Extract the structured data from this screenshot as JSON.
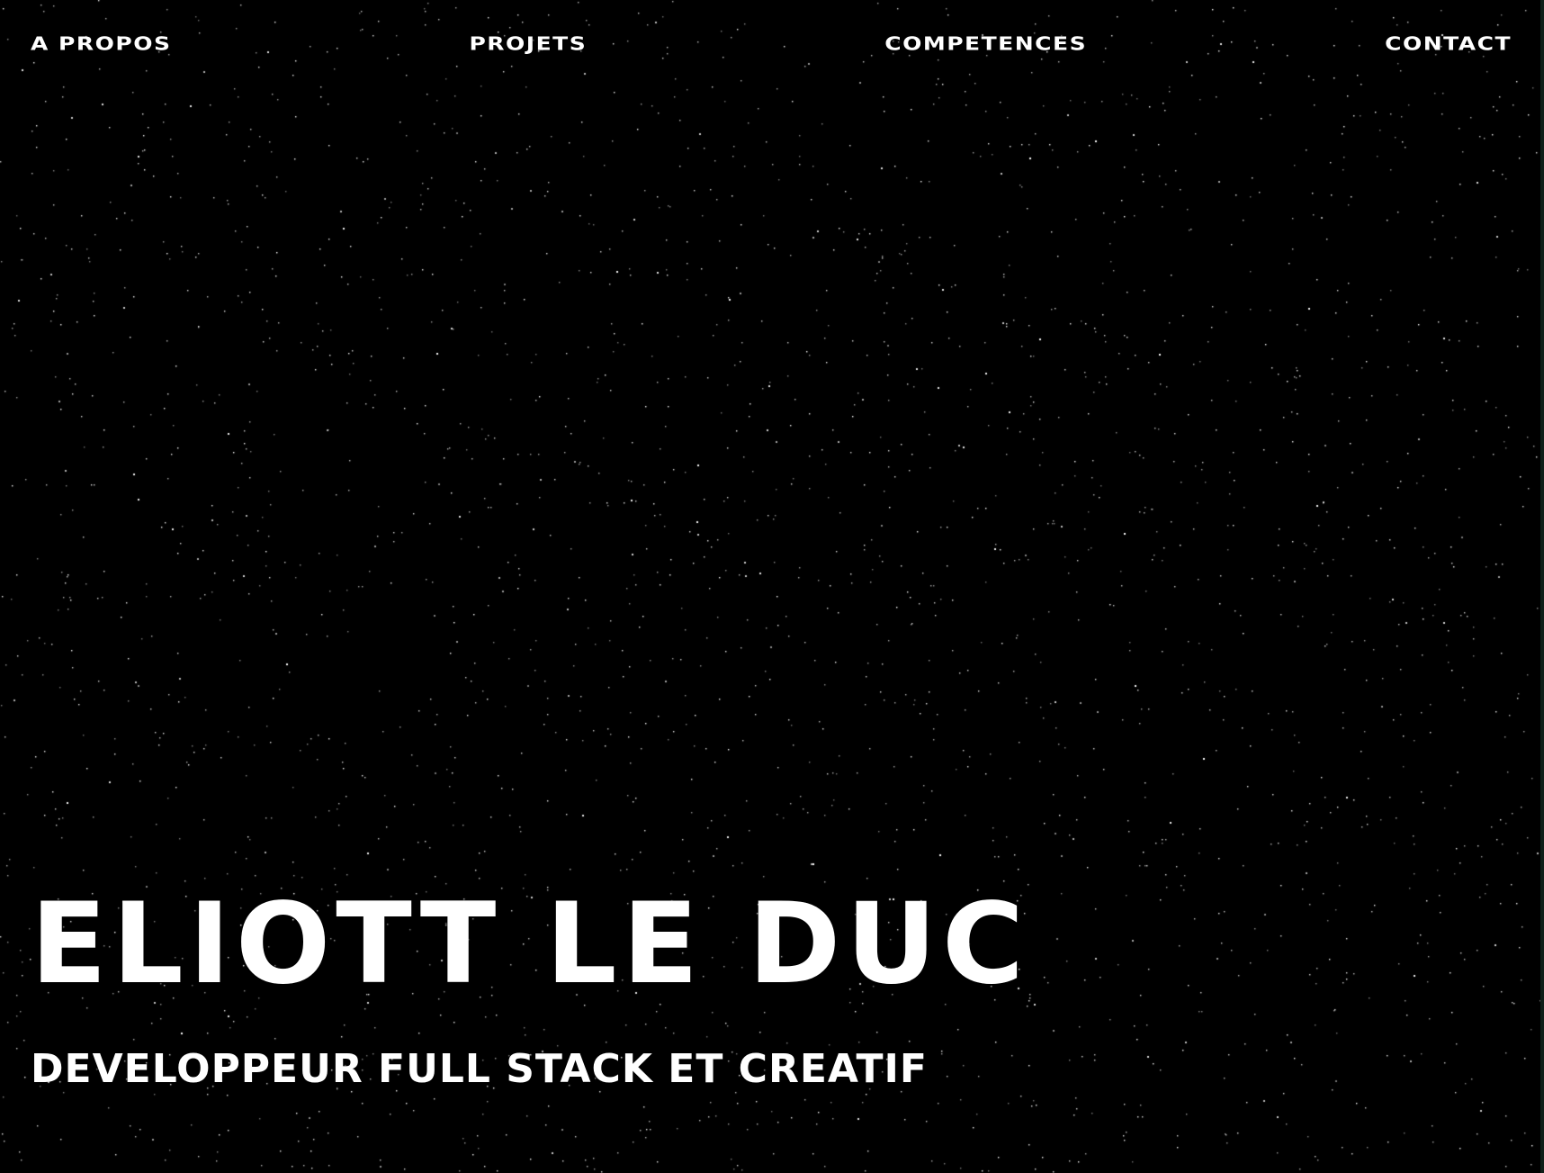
{
  "colors": {
    "background": "#000000",
    "text": "#ffffff",
    "stars": "#ffffff",
    "edge": "#0f1f18"
  },
  "nav": {
    "items": [
      {
        "label": "A PROPOS"
      },
      {
        "label": "PROJETS"
      },
      {
        "label": "COMPETENCES"
      },
      {
        "label": "CONTACT"
      }
    ]
  },
  "hero": {
    "name": "ELIOTT LE DUC",
    "tagline": "DEVELOPPEUR FULL STACK ET CREATIF"
  }
}
